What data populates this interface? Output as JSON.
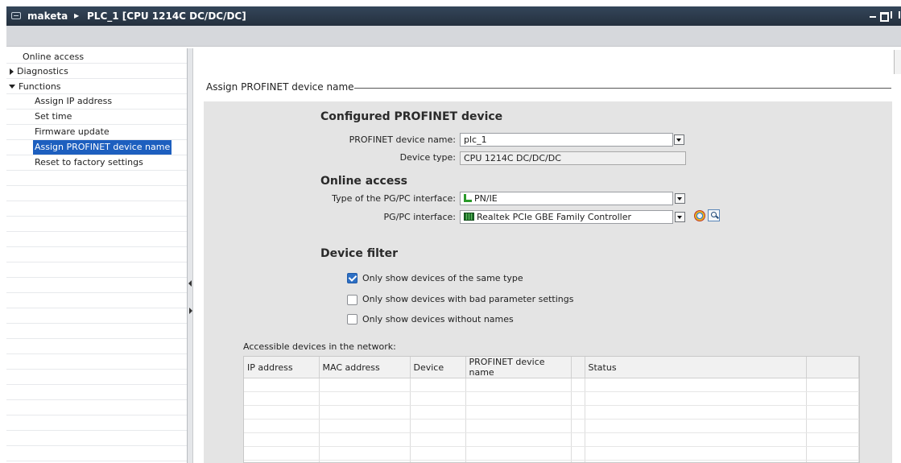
{
  "window": {
    "crumb_project": "maketa",
    "crumb_device": "PLC_1 [CPU 1214C DC/DC/DC]"
  },
  "sidebar": {
    "online_access": "Online access",
    "diagnostics": "Diagnostics",
    "functions": "Functions",
    "items": [
      {
        "label": "Assign IP address"
      },
      {
        "label": "Set time"
      },
      {
        "label": "Firmware update"
      },
      {
        "label": "Assign PROFINET device name"
      },
      {
        "label": "Reset to factory settings"
      }
    ],
    "selected_item": "Assign PROFINET device name"
  },
  "section": {
    "title": "Assign PROFINET device name"
  },
  "configured": {
    "heading": "Configured PROFINET device",
    "name_label": "PROFINET device name:",
    "name_value": "plc_1",
    "type_label": "Device type:",
    "type_value": "CPU 1214C DC/DC/DC"
  },
  "online": {
    "heading": "Online access",
    "iface_type_label": "Type of the PG/PC interface:",
    "iface_type_value": "PN/IE",
    "iface_label": "PG/PC interface:",
    "iface_value": "Realtek PCIe GBE Family Controller"
  },
  "filter": {
    "heading": "Device filter",
    "options": [
      {
        "label": "Only show devices of the same type",
        "checked": true
      },
      {
        "label": "Only show devices with bad parameter settings",
        "checked": false
      },
      {
        "label": "Only show devices without names",
        "checked": false
      }
    ]
  },
  "network_table": {
    "caption": "Accessible devices in the network:",
    "columns": [
      "IP address",
      "MAC address",
      "Device",
      "PROFINET device name",
      "",
      "Status",
      ""
    ]
  },
  "icons": {
    "window": "window-icon",
    "breadcrumb_sep": "chevron-right-icon",
    "pnie": "pn-ie-network-icon",
    "nic": "network-card-icon",
    "shield": "online-status-icon",
    "search": "search-icon"
  }
}
